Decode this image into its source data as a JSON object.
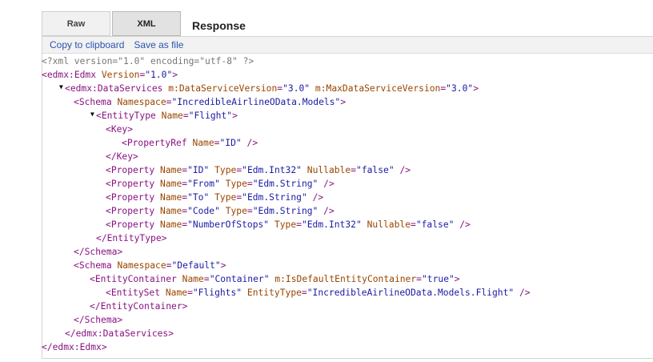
{
  "tabs": {
    "raw": "Raw",
    "xml": "XML"
  },
  "response_label": "Response",
  "toolbar": {
    "copy": "Copy to clipboard",
    "save": "Save as file"
  },
  "icons": {
    "expanded_twisty": "triangle-down-icon"
  },
  "colors": {
    "tag": "#881280",
    "attr_name": "#994500",
    "attr_value": "#1a1aa6",
    "prolog": "#777777",
    "link": "#2a54b0"
  },
  "xml": {
    "prolog": "<?xml version=\"1.0\" encoding=\"utf-8\" ?>",
    "edmx_open": {
      "tag": "edmx:Edmx",
      "attr": "Version",
      "val": "\"1.0\""
    },
    "ds_open": {
      "tag": "edmx:DataServices",
      "a1": "m:DataServiceVersion",
      "v1": "\"3.0\"",
      "a2": "m:MaxDataServiceVersion",
      "v2": "\"3.0\""
    },
    "schema1_open": {
      "tag": "Schema",
      "attr": "Namespace",
      "val": "\"IncredibleAirlineOData.Models\""
    },
    "entitytype_open": {
      "tag": "EntityType",
      "attr": "Name",
      "val": "\"Flight\""
    },
    "key_open": {
      "tag": "Key"
    },
    "propref": {
      "tag": "PropertyRef",
      "attr": "Name",
      "val": "\"ID\""
    },
    "key_close": {
      "tag": "/Key"
    },
    "properties": [
      {
        "tag": "Property",
        "name": "\"ID\"",
        "type": "\"Edm.Int32\"",
        "nullable": "\"false\""
      },
      {
        "tag": "Property",
        "name": "\"From\"",
        "type": "\"Edm.String\"",
        "nullable": ""
      },
      {
        "tag": "Property",
        "name": "\"To\"",
        "type": "\"Edm.String\"",
        "nullable": ""
      },
      {
        "tag": "Property",
        "name": "\"Code\"",
        "type": "\"Edm.String\"",
        "nullable": ""
      },
      {
        "tag": "Property",
        "name": "\"NumberOfStops\"",
        "type": "\"Edm.Int32\"",
        "nullable": "\"false\""
      }
    ],
    "attr_names": {
      "name": "Name",
      "type": "Type",
      "nullable": "Nullable"
    },
    "entitytype_close": {
      "tag": "/EntityType"
    },
    "schema_close": {
      "tag": "/Schema"
    },
    "schema2_open": {
      "tag": "Schema",
      "attr": "Namespace",
      "val": "\"Default\""
    },
    "container_open": {
      "tag": "EntityContainer",
      "a1": "Name",
      "v1": "\"Container\"",
      "a2": "m:IsDefaultEntityContainer",
      "v2": "\"true\""
    },
    "entityset": {
      "tag": "EntitySet",
      "a1": "Name",
      "v1": "\"Flights\"",
      "a2": "EntityType",
      "v2": "\"IncredibleAirlineOData.Models.Flight\""
    },
    "container_close": {
      "tag": "/EntityContainer"
    },
    "schema2_close": {
      "tag": "/Schema"
    },
    "ds_close": {
      "tag": "/edmx:DataServices"
    },
    "edmx_close": {
      "tag": "/edmx:Edmx"
    }
  }
}
